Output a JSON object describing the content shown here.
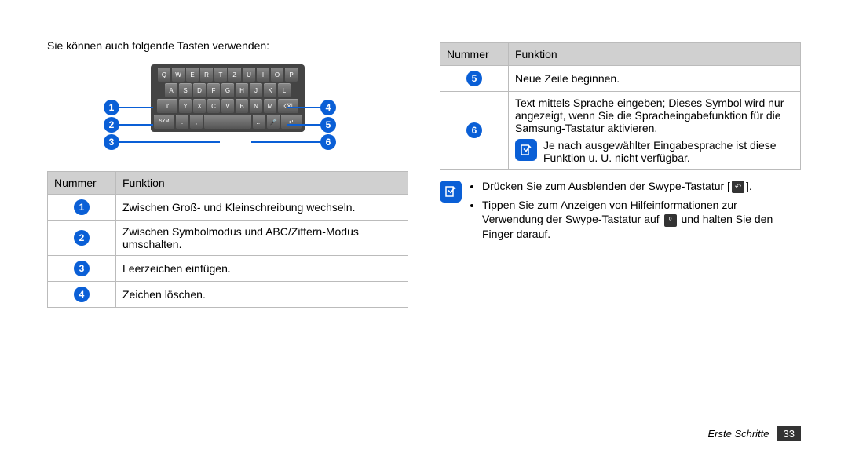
{
  "left": {
    "intro": "Sie können auch folgende Tasten verwenden:",
    "keyboard": {
      "rows": [
        [
          "Q",
          "W",
          "E",
          "R",
          "T",
          "Z",
          "U",
          "I",
          "O",
          "P"
        ],
        [
          "A",
          "S",
          "D",
          "F",
          "G",
          "H",
          "J",
          "K",
          "L"
        ],
        [
          "⇧",
          "Y",
          "X",
          "C",
          "V",
          "B",
          "N",
          "M",
          "⌫"
        ],
        [
          "SYM",
          ".",
          ",",
          "␣",
          "…",
          "🎤",
          "↵"
        ]
      ]
    },
    "callouts": {
      "c1": "1",
      "c2": "2",
      "c3": "3",
      "c4": "4",
      "c5": "5",
      "c6": "6"
    },
    "table": {
      "headers": {
        "num": "Nummer",
        "func": "Funktion"
      },
      "rows": [
        {
          "n": "1",
          "text": "Zwischen Groß- und Kleinschreibung wechseln."
        },
        {
          "n": "2",
          "text": "Zwischen Symbolmodus und ABC/Ziffern-Modus umschalten."
        },
        {
          "n": "3",
          "text": "Leerzeichen einfügen."
        },
        {
          "n": "4",
          "text": "Zeichen löschen."
        }
      ]
    }
  },
  "right": {
    "table": {
      "headers": {
        "num": "Nummer",
        "func": "Funktion"
      },
      "rows": [
        {
          "n": "5",
          "text": "Neue Zeile beginnen."
        },
        {
          "n": "6",
          "text": "Text mittels Sprache eingeben; Dieses Symbol wird nur angezeigt, wenn Sie die Spracheingabefunktion für die Samsung-Tastatur aktivieren.",
          "note": "Je nach ausgewählter Eingabesprache ist diese Funktion u. U. nicht verfügbar."
        }
      ]
    },
    "tips": [
      {
        "pre": "Drücken Sie zum Ausblenden der Swype-Tastatur [",
        "iconName": "back-icon",
        "post": "]."
      },
      {
        "pre": "Tippen Sie zum Anzeigen von Hilfeinformationen zur Verwendung der Swype-Tastatur auf ",
        "iconName": "swype-help-icon",
        "post": " und halten Sie den Finger darauf."
      }
    ]
  },
  "footer": {
    "section": "Erste Schritte",
    "page": "33"
  }
}
